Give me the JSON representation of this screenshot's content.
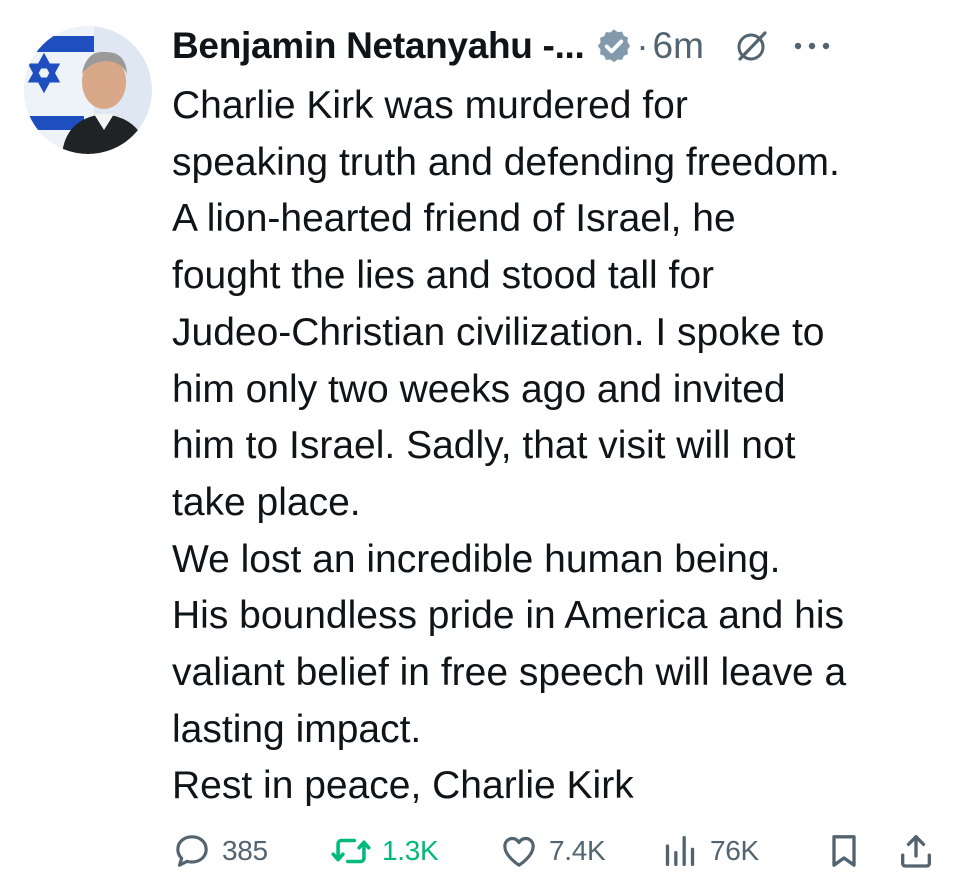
{
  "post": {
    "author": {
      "name": "Benjamin Netanyahu -...",
      "verified_icon": "verified-badge-icon",
      "avatar_icon": "avatar"
    },
    "separator": "·",
    "timestamp": "6m",
    "body_lines": [
      "Charlie Kirk was murdered for",
      "speaking truth and defending freedom.",
      "A lion-hearted friend of Israel, he",
      "fought the lies and stood tall for",
      "Judeo-Christian civilization. I spoke to",
      "him only two weeks ago and invited",
      "him to Israel. Sadly, that visit will not",
      "take place.",
      "We lost an incredible human being.",
      "His boundless pride in America and his",
      "valiant belief in free speech will leave a",
      "lasting impact.",
      "Rest in peace, Charlie Kirk"
    ],
    "actions": {
      "replies": "385",
      "reposts": "1.3K",
      "likes": "7.4K",
      "views": "76K"
    },
    "colors": {
      "text": "#0f1419",
      "muted": "#536471",
      "repost_active": "#00ba7c",
      "verified": "#829aab"
    },
    "icons": [
      "reply-icon",
      "repost-icon",
      "like-icon",
      "views-icon",
      "bookmark-icon",
      "share-icon",
      "grok-icon",
      "more-icon"
    ]
  }
}
